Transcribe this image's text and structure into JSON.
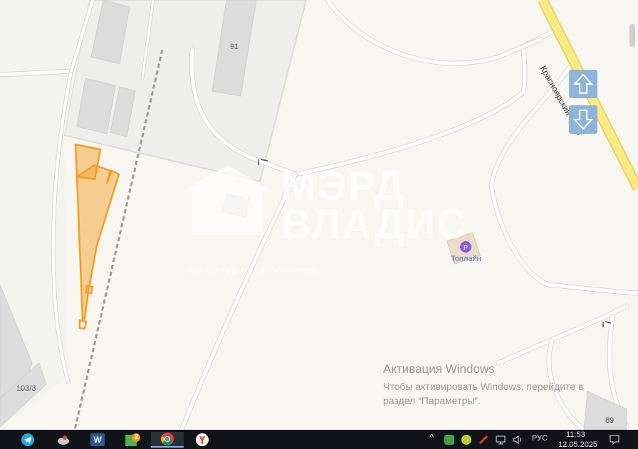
{
  "map": {
    "building_labels": [
      "91",
      "103/3",
      "89"
    ],
    "road_label": "Красноярский тракт",
    "poi": {
      "name": "Топлайн",
      "icon": "gas-station-icon",
      "color": "#8a5cd6"
    },
    "plot_color": "#f59d22",
    "watermark": {
      "name": "МЭРД",
      "brand": "ВЛАДИС",
      "subtitle": "агентство недвижимости"
    },
    "nav": {
      "up_icon": "arrow-up-icon",
      "down_icon": "arrow-down-icon",
      "button_color": "#8fb3d9"
    }
  },
  "activation": {
    "title": "Активация Windows",
    "text": "Чтобы активировать Windows, перейдите в раздел “Параметры”."
  },
  "taskbar": {
    "apps": [
      {
        "name": "telegram-icon"
      },
      {
        "name": "satellite-app-icon"
      },
      {
        "name": "word-icon",
        "label": "W"
      },
      {
        "name": "app-badge-icon",
        "label": "2"
      },
      {
        "name": "chrome-icon"
      },
      {
        "name": "yandex-browser-icon"
      }
    ],
    "language": "РУС",
    "time": "11:53",
    "date": "12.05.2025"
  }
}
